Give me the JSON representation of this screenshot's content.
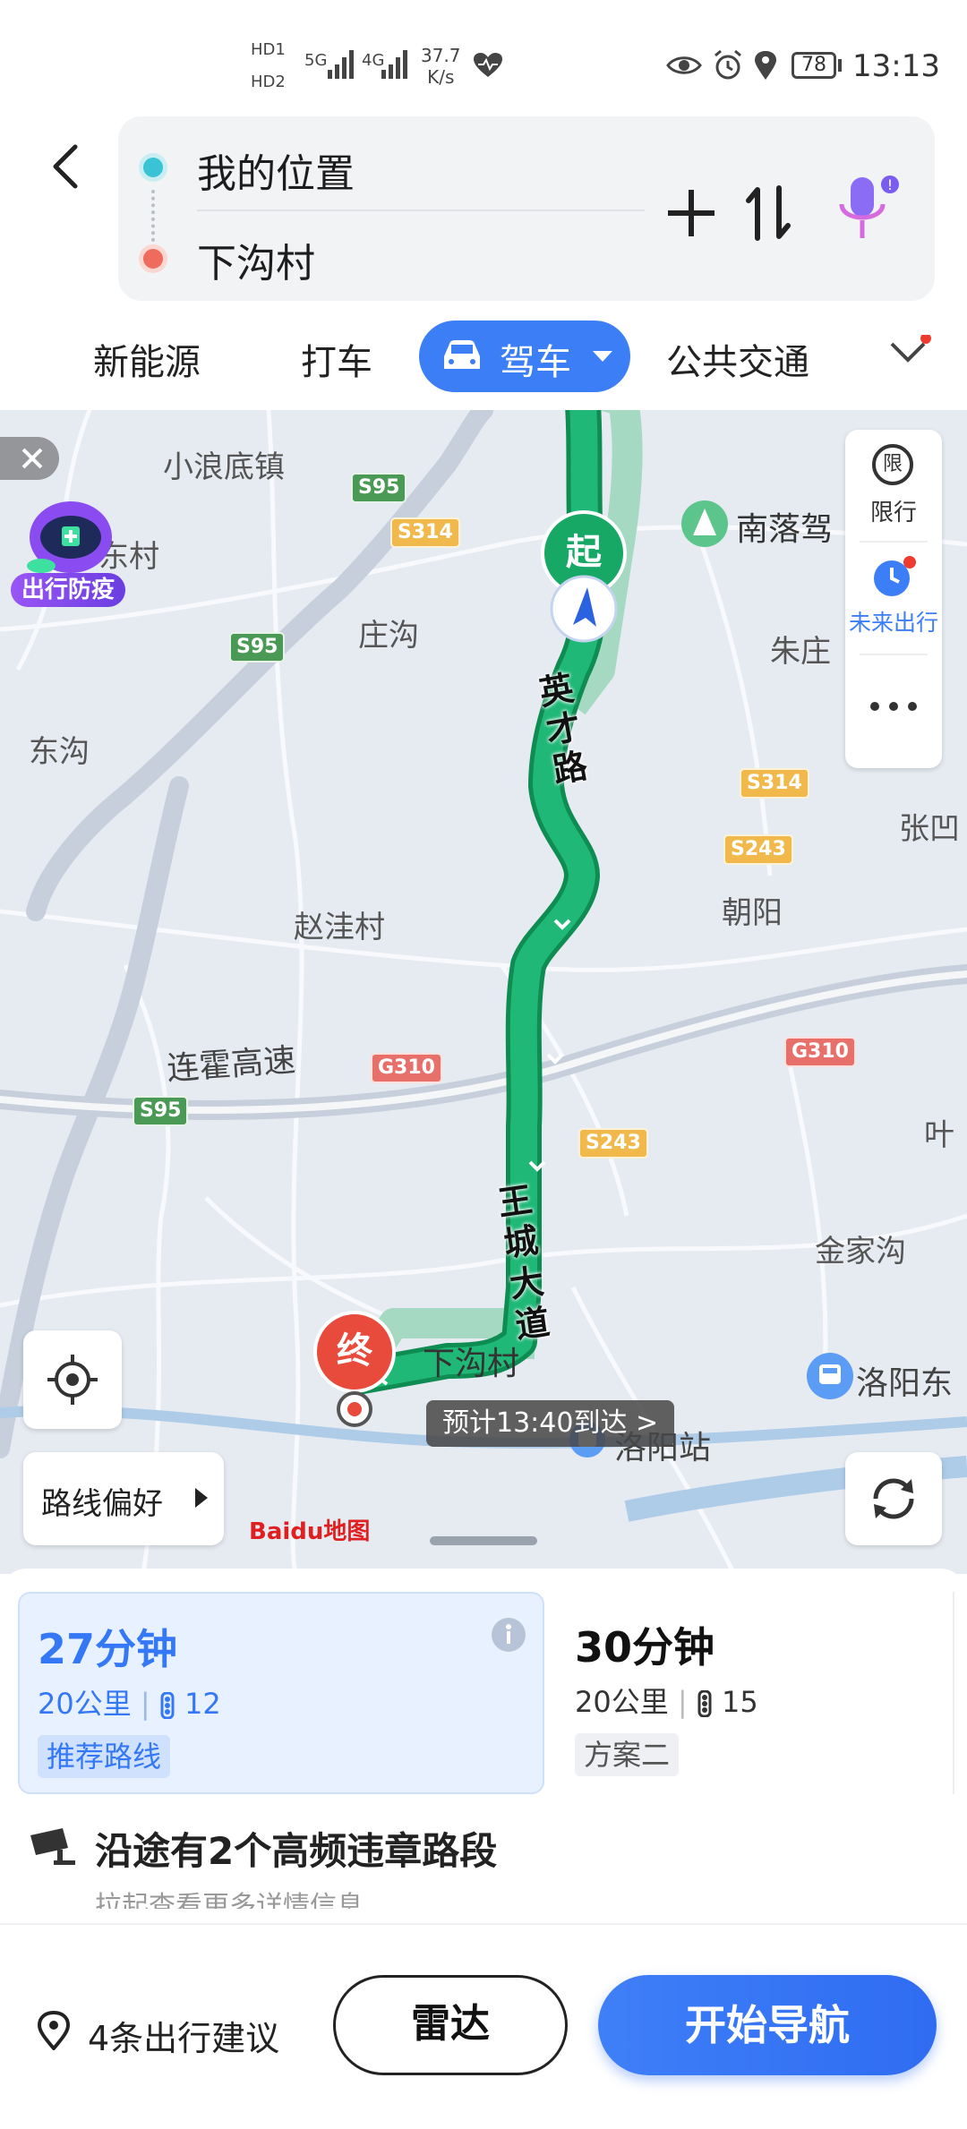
{
  "status_bar": {
    "hd1": "HD1",
    "hd2": "HD2",
    "net1": "5G",
    "net2": "4G",
    "speed_value": "37.7",
    "speed_unit": "K/s",
    "battery": "78",
    "time": "13:13"
  },
  "route": {
    "origin": "我的位置",
    "destination": "下沟村"
  },
  "tabs": [
    {
      "label": "新能源"
    },
    {
      "label": "打车"
    },
    {
      "label": "驾车"
    },
    {
      "label": "公共交通"
    }
  ],
  "map": {
    "labels": {
      "xiaolangdi": "小浪底镇",
      "dongcun": "东村",
      "zhuanggou": "庄沟",
      "donggou": "东沟",
      "nanluojia": "南落驾",
      "zhuzhuang": "朱庄",
      "zhangao": "张凹",
      "zhaowa": "赵洼村",
      "chaoyang": "朝阳",
      "lianhuo": "连霍高速",
      "ye": "叶",
      "jinjiagou": "金家沟",
      "xiagoucun": "下沟村",
      "luoyangdong": "洛阳东",
      "luoyangzhan": "洛阳站"
    },
    "road_names": {
      "yingcai": "英才路",
      "wangcheng": "王城大道"
    },
    "shields": {
      "s95": "S95",
      "s314": "S314",
      "s243": "S243",
      "g310": "G310"
    },
    "start_marker": "起",
    "end_marker": "终",
    "eta": "预计13:40到达 >",
    "side_tools": {
      "restriction_label": "限行",
      "restriction_icon_text": "限",
      "future_trip_label": "未来出行"
    },
    "epidemic_badge": "出行防疫",
    "route_pref": "路线偏好",
    "logo_text": "Baidu地图",
    "route_color": "#1fb877"
  },
  "route_options": [
    {
      "duration": "27分钟",
      "distance": "20公里",
      "lights": "12",
      "tag": "推荐路线"
    },
    {
      "duration": "30分钟",
      "distance": "20公里",
      "lights": "15",
      "tag": "方案二"
    }
  ],
  "violation": {
    "title": "沿途有2个高频违章路段",
    "subtitle": "拉起查看更多详情信息"
  },
  "actions": {
    "suggestions": "4条出行建议",
    "radar": "雷达",
    "start_nav": "开始导航"
  },
  "colors": {
    "accent": "#3478f6",
    "route_green": "#1fb877",
    "start_green": "#17a866",
    "end_red": "#e84a3c"
  }
}
